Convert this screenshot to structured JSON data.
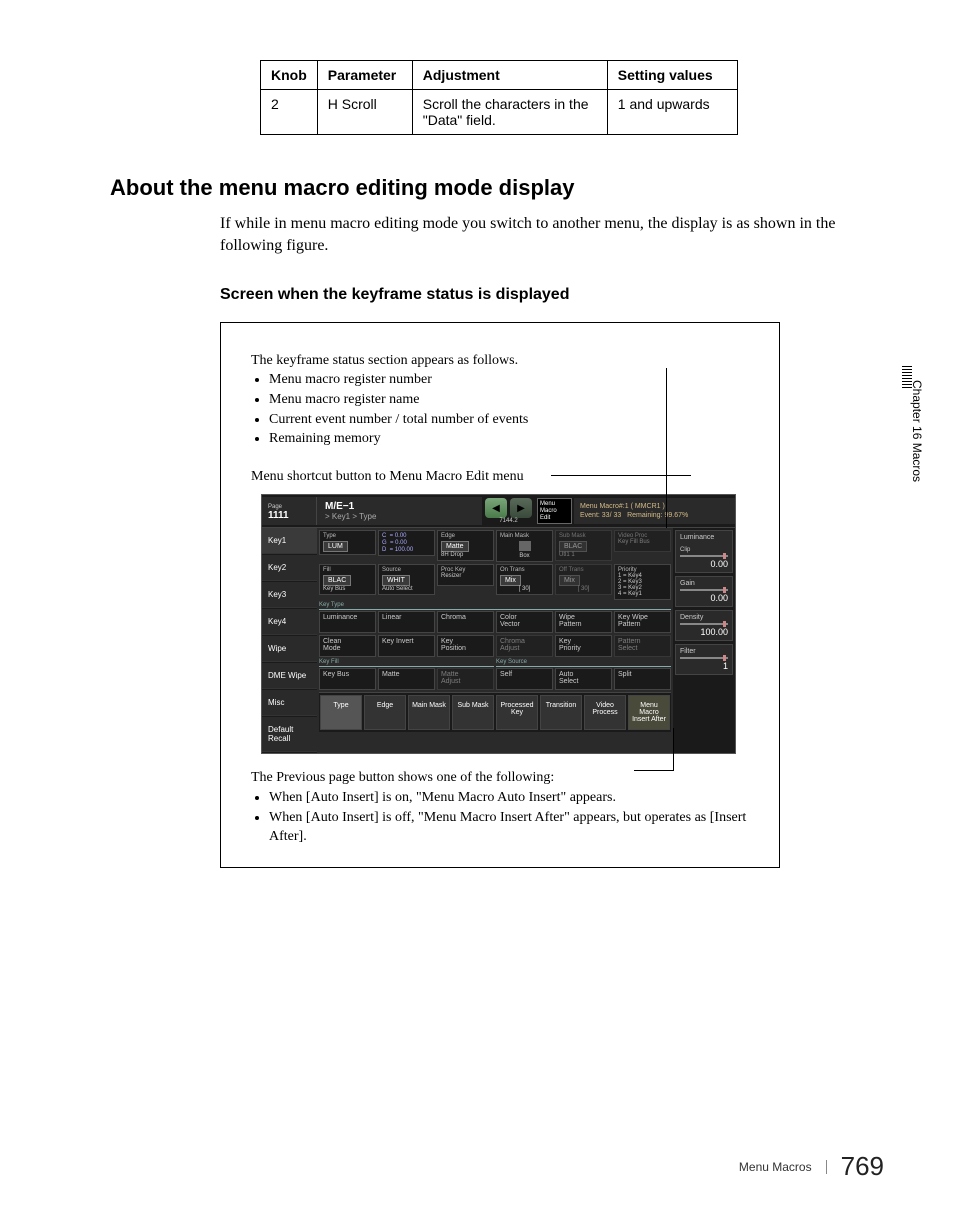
{
  "knob_table": {
    "headers": [
      "Knob",
      "Parameter",
      "Adjustment",
      "Setting values"
    ],
    "row": {
      "knob": "2",
      "parameter": "H Scroll",
      "adjustment": "Scroll the characters in the \"Data\" field.",
      "setting": "1 and upwards"
    }
  },
  "heading": "About the menu macro editing mode display",
  "body": "If while in menu macro editing mode you switch to another menu, the display is as shown in the following figure.",
  "subheading": "Screen when the keyframe status is displayed",
  "callout_top": {
    "intro": "The keyframe status section appears as follows.",
    "bullets": [
      "Menu macro register number",
      "Menu macro register name",
      "Current event number / total number of events",
      "Remaining memory"
    ]
  },
  "callout_shortcut": "Menu shortcut button to Menu Macro Edit menu",
  "callout_bottom": {
    "intro": "The Previous page button shows one of the following:",
    "bullets": [
      "When [Auto Insert] is on, \"Menu Macro Auto Insert\" appears.",
      "When [Auto Insert] is off, \"Menu Macro Insert After\" appears, but operates as [Insert After]."
    ]
  },
  "side_tab": "Chapter 16  Macros",
  "footer": {
    "label": "Menu Macros",
    "page": "769"
  },
  "scr": {
    "page_label": "Page",
    "page_number": "1111",
    "title": "M/E−1",
    "breadcrumb": "> Key1 > Type",
    "arrow_sub": "7144.2",
    "macro_btn": "Menu\nMacro\nEdit",
    "status_l1": "Menu Macro#:1 ( MMCR1 )",
    "status_l2_a": "Event:  33/ 33",
    "status_l2_b": "Remaining: 99.67%",
    "sidebar": [
      "Key1",
      "Key2",
      "Key3",
      "Key4",
      "Wipe",
      "DME Wipe",
      "Misc",
      "Default Recall"
    ],
    "row1": {
      "type_lbl": "Type",
      "type_btn": "LUM",
      "vals": "C  = 0.00\nG  = 0.00\nD  = 100.00",
      "edge_lbl": "Edge",
      "edge_btn": "Matte",
      "edge_sub": "8H Drop",
      "mask_lbl": "Main Mask",
      "mask_sub": "Box",
      "sub_lbl": "Sub Mask",
      "sub_btn": "BLAC",
      "sub_sub": "Utl1 1",
      "vproc_lbl": "Video Proc",
      "vproc_btn": "Key Fill Bus"
    },
    "row2": {
      "fill_lbl": "Fill",
      "fill_btn": "BLAC",
      "fill_sub": "Key Bus",
      "src_lbl": "Source",
      "src_btn": "WHIT",
      "src_sub": "Auto Select",
      "proc_lbl": "Proc Key",
      "proc_btn": "Resizer",
      "on_lbl": "On Trans",
      "on_btn": "Mix",
      "on_sub": "[ 30]",
      "off_lbl": "Off Trans",
      "off_btn": "Mix",
      "off_sub": "[ 30]",
      "pri_lbl": "Priority",
      "pri_vals": "1 = Key4\n2 = Key3\n3 = Key2\n4 = Key1"
    },
    "row3": {
      "group": "Key Type",
      "c1_lbl": "Luminance",
      "c2_lbl": "Linear",
      "c3_lbl": "Chroma",
      "c4_lbl": "Color\nVector",
      "c5_lbl": "Wipe\nPattern",
      "c6_lbl": "Key Wipe\nPattern"
    },
    "row4": {
      "c1_lbl": "Clean\nMode",
      "c2_lbl": "Key Invert",
      "c3_lbl": "Key\nPosition",
      "c4_lbl": "Chroma\nAdjust",
      "c5_lbl": "Key\nPriority",
      "c6_lbl": "Pattern\nSelect"
    },
    "row5": {
      "group1": "Key Fill",
      "group2": "Key Source",
      "c1_lbl": "Key Bus",
      "c2_lbl": "Matte",
      "c3_lbl": "Matte\nAdjust",
      "c4_lbl": "Self",
      "c5_lbl": "Auto\nSelect",
      "c6_lbl": "Split"
    },
    "bottom": [
      "Type",
      "Edge",
      "Main Mask",
      "Sub Mask",
      "Processed\nKey",
      "Transition",
      "Video\nProcess",
      "Menu Macro\nInsert After"
    ],
    "right": [
      {
        "lbl": "Luminance",
        "sub": "Clip",
        "val": "0.00"
      },
      {
        "lbl": "Gain",
        "val": "0.00"
      },
      {
        "lbl": "Density",
        "val": "100.00"
      },
      {
        "lbl": "Filter",
        "val": "1"
      }
    ]
  }
}
